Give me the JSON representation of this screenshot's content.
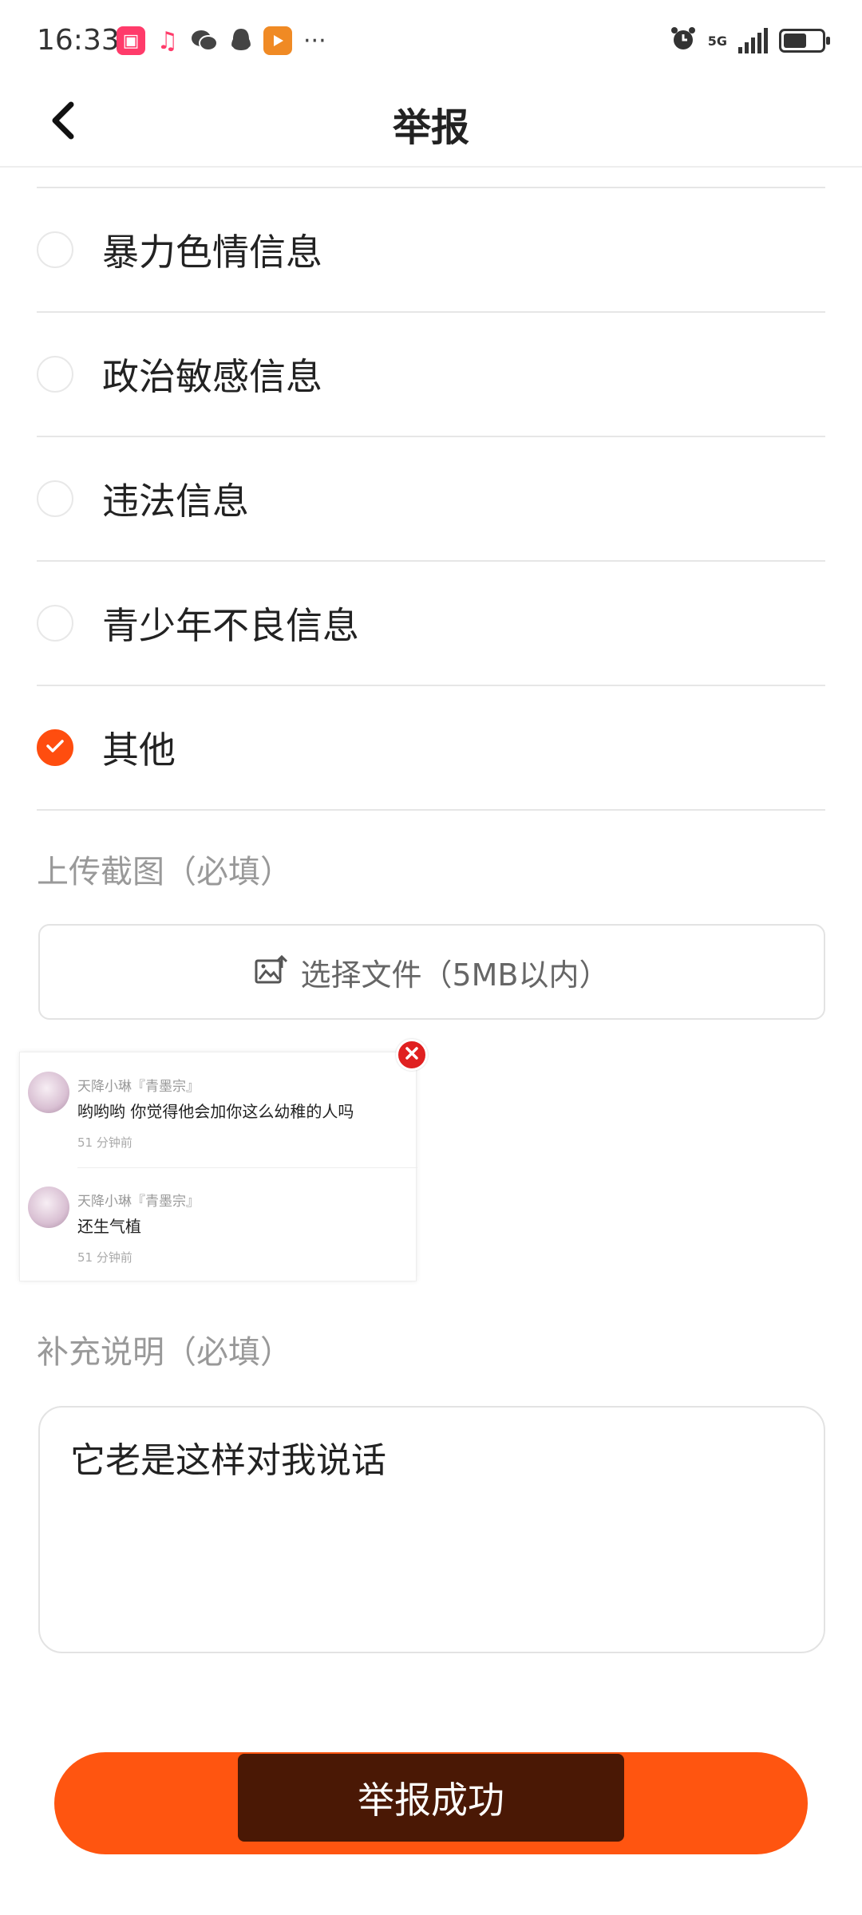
{
  "status_bar": {
    "time": "16:33",
    "apps": [
      "kuaikan-icon",
      "music-icon",
      "wechat-icon",
      "qq-icon",
      "video-icon"
    ],
    "more": "···",
    "network": "5G",
    "battery_level": 0.6
  },
  "header": {
    "title": "举报",
    "back_icon": "chevron-left-icon"
  },
  "options": [
    {
      "label": "暴力色情信息",
      "checked": false
    },
    {
      "label": "政治敏感信息",
      "checked": false
    },
    {
      "label": "违法信息",
      "checked": false
    },
    {
      "label": "青少年不良信息",
      "checked": false
    },
    {
      "label": "其他",
      "checked": true
    }
  ],
  "upload": {
    "label": "上传截图（必填）",
    "button_label": "选择文件（5MB以内）",
    "icon": "image-upload-icon"
  },
  "screenshot": {
    "comments": [
      {
        "name": "天降小琳『青墨宗』",
        "text": "哟哟哟 你觉得他会加你这么幼稚的人吗",
        "time": "51 分钟前"
      },
      {
        "name": "天降小琳『青墨宗』",
        "text": "还生气植",
        "time": "51 分钟前"
      }
    ]
  },
  "description": {
    "label": "补充说明（必填）",
    "value": "它老是这样对我说话"
  },
  "submit": {
    "toast": "举报成功"
  },
  "colors": {
    "accent": "#ff5510",
    "checked": "#ff4d0f",
    "toast_bg": "#4a1805",
    "delete": "#e02020"
  }
}
